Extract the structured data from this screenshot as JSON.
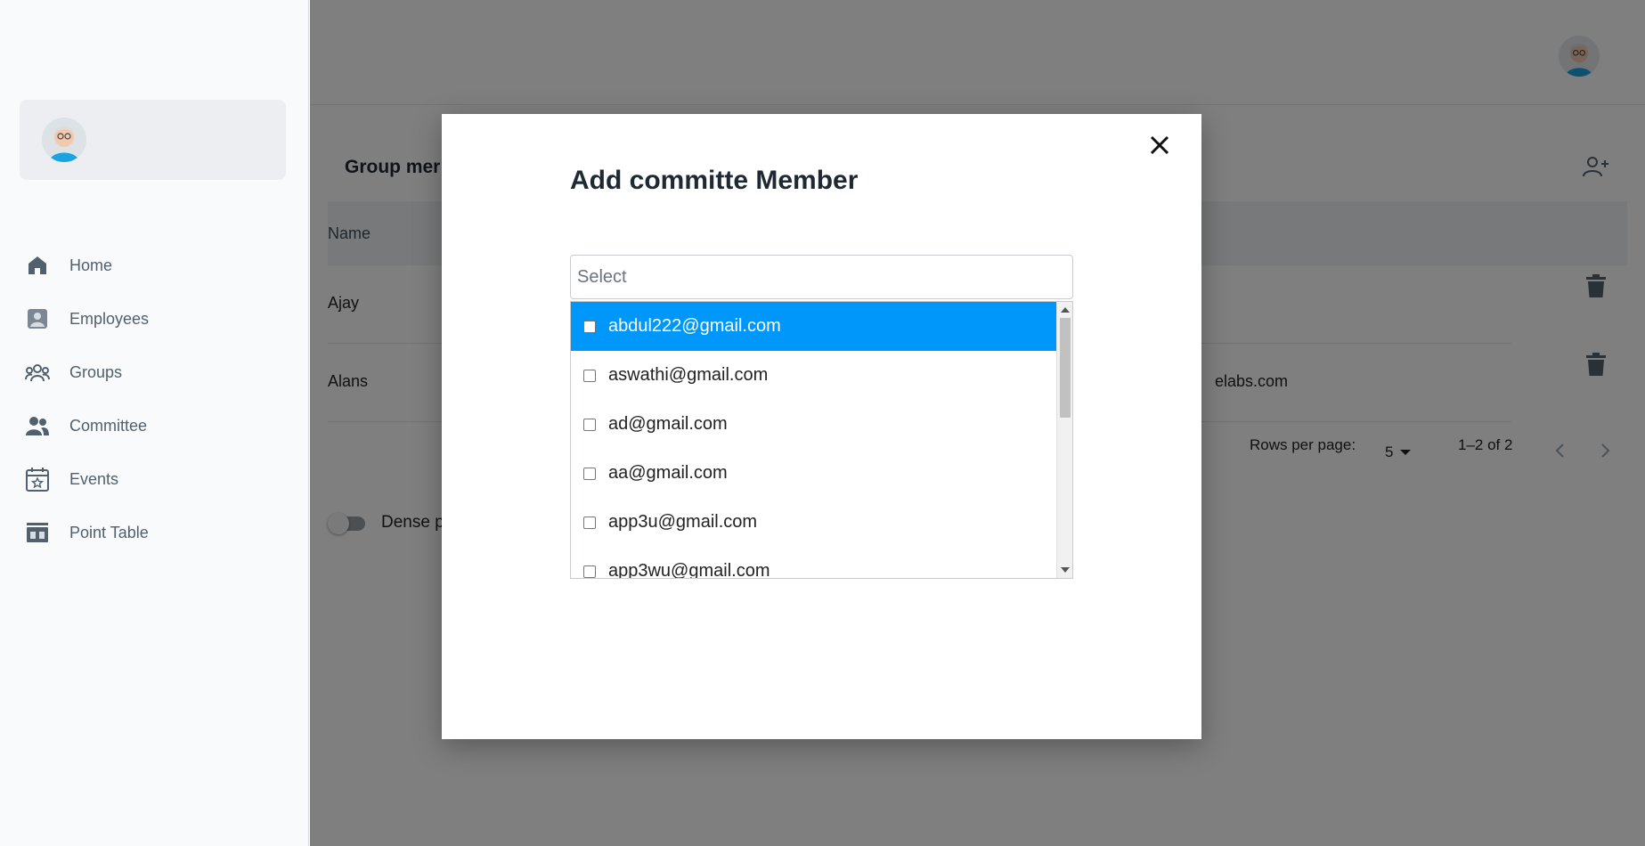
{
  "sidebar": {
    "items": [
      {
        "label": "Home",
        "icon": "home-icon"
      },
      {
        "label": "Employees",
        "icon": "employee-badge-icon"
      },
      {
        "label": "Groups",
        "icon": "groups-icon"
      },
      {
        "label": "Committee",
        "icon": "committee-icon"
      },
      {
        "label": "Events",
        "icon": "calendar-icon"
      },
      {
        "label": "Point Table",
        "icon": "point-table-icon"
      }
    ]
  },
  "main": {
    "title": "Group mer",
    "table": {
      "headers": [
        "Name"
      ],
      "rows": [
        {
          "name": "Ajay",
          "email": ""
        },
        {
          "name": "Alans",
          "email": "elabs.com"
        }
      ]
    },
    "pagination": {
      "rows_per_page_label": "Rows per page:",
      "rows_per_page_value": "5",
      "range_label": "1–2 of 2"
    },
    "dense_label": "Dense p"
  },
  "modal": {
    "title": "Add committe Member",
    "select_placeholder": "Select",
    "options": [
      "abdul222@gmail.com",
      "aswathi@gmail.com",
      "ad@gmail.com",
      "aa@gmail.com",
      "app3u@gmail.com",
      "app3wu@gmail.com"
    ],
    "selected_index": 0
  },
  "colors": {
    "highlight": "#0097fb",
    "overlay": "rgba(0,0,0,0.5)",
    "sidebar_bg": "#f8fafc",
    "icon": "#52606d"
  }
}
